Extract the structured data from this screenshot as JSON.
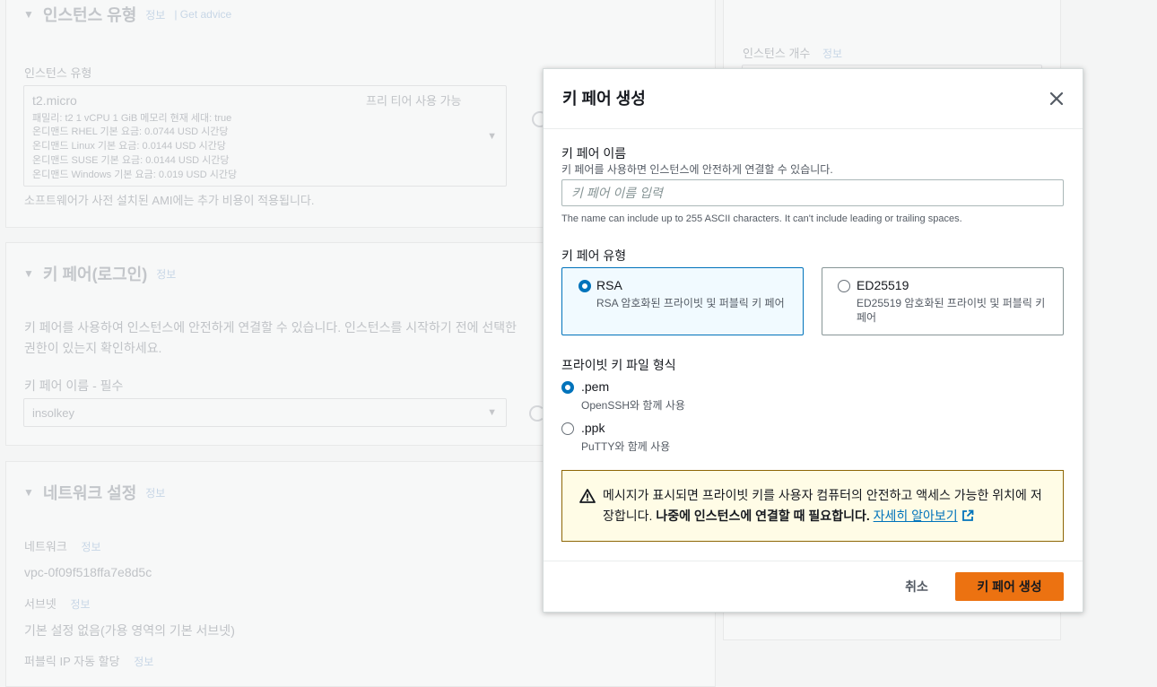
{
  "background": {
    "instance_type": {
      "title": "인스턴스 유형",
      "info": "정보",
      "advice": "| Get advice",
      "field_label": "인스턴스 유형",
      "selected": "t2.micro",
      "free_tier": "프리 티어 사용 가능",
      "details": [
        "패밀리: t2    1 vCPU    1 GiB 메모리    현재 세대: true",
        "온디맨드 RHEL 기본 요금: 0.0744 USD 시간당",
        "온디맨드 Linux 기본 요금: 0.0144 USD 시간당",
        "온디맨드 SUSE 기본 요금: 0.0144 USD 시간당",
        "온디맨드 Windows 기본 요금: 0.019 USD 시간당"
      ],
      "note": "소프트웨어가 사전 설치된 AMI에는 추가 비용이 적용됩니다."
    },
    "keypair": {
      "title": "키 페어(로그인)",
      "info": "정보",
      "desc_line1": "키 페어를 사용하여 인스턴스에 안전하게 연결할 수 있습니다. 인스턴스를 시작하기 전에 선택한",
      "desc_line2": "권한이 있는지 확인하세요.",
      "field_label": "키 페어 이름 - 필수",
      "selected": "insolkey"
    },
    "network": {
      "title": "네트워크 설정",
      "info": "정보",
      "network_label": "네트워크",
      "network_info": "정보",
      "network_value": "vpc-0f09f518ffa7e8d5c",
      "subnet_label": "서브넷",
      "subnet_info": "정보",
      "subnet_value": "기본 설정 없음(가용 영역의 기본 서브넷)",
      "public_ip_label": "퍼블릭 IP 자동 할당",
      "public_ip_info": "정보"
    },
    "summary": {
      "count_label": "인스턴스 개수",
      "count_info": "정보"
    }
  },
  "modal": {
    "title": "키 페어 생성",
    "name_label": "키 페어 이름",
    "name_desc": "키 페어를 사용하면 인스턴스에 안전하게 연결할 수 있습니다.",
    "name_placeholder": "키 페어 이름 입력",
    "name_value": "",
    "name_constraint": "The name can include up to 255 ASCII characters. It can't include leading or trailing spaces.",
    "type_label": "키 페어 유형",
    "types": [
      {
        "title": "RSA",
        "desc": "RSA 암호화된 프라이빗 및 퍼블릭 키 페어",
        "selected": true
      },
      {
        "title": "ED25519",
        "desc": "ED25519 암호화된 프라이빗 및 퍼블릭 키 페어",
        "selected": false
      }
    ],
    "format_label": "프라이빗 키 파일 형식",
    "formats": [
      {
        "title": ".pem",
        "desc": "OpenSSH와 함께 사용",
        "selected": true
      },
      {
        "title": ".ppk",
        "desc": "PuTTY와 함께 사용",
        "selected": false
      }
    ],
    "alert_text_1": "메시지가 표시되면 프라이빗 키를 사용자 컴퓨터의 안전하고 액세스 가능한 위치에 저장합니다. ",
    "alert_bold": "나중에 인스턴스에 연결할 때 필요합니다.",
    "alert_link": "자세히 알아보기",
    "cancel_label": "취소",
    "create_label": "키 페어 생성"
  },
  "colors": {
    "accent": "#0073bb",
    "primary_button": "#ec7211",
    "warning_bg": "#fffce6",
    "warning_border": "#8d6605"
  }
}
